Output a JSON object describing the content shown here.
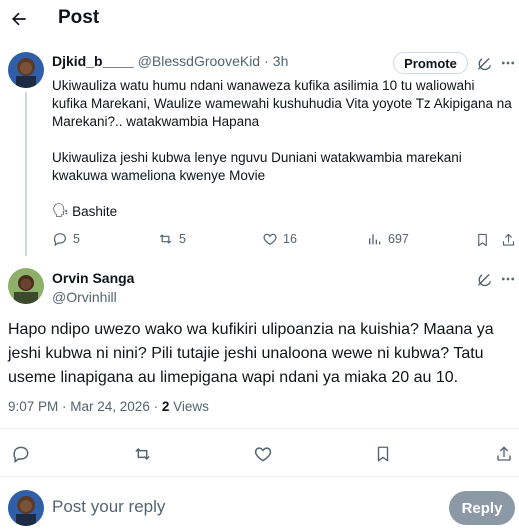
{
  "header": {
    "title": "Post"
  },
  "parent_post": {
    "author_name": "Djkid_b____",
    "author_handle": "@BlessdGrooveKid",
    "separator": "·",
    "time": "3h",
    "promote_label": "Promote",
    "paragraphs": [
      "Ukiwauliza watu humu ndani wanaweza kufika asilimia 10 tu waliowahi kufika Marekani, Waulize wamewahi kushuhudia Vita yoyote Tz Akipigana na Marekani?.. watakwambia Hapana",
      "Ukiwauliza jeshi kubwa lenye nguvu Duniani watakwambia marekani kwakuwa wameliona kwenye Movie"
    ],
    "signature_emoji": "🗣",
    "signature_text": "Bashite",
    "stats": {
      "replies": "5",
      "reposts": "5",
      "likes": "16",
      "views": "697"
    }
  },
  "reply_post": {
    "author_name": "Orvin Sanga",
    "author_handle": "@Orvinhill",
    "text": "Hapo ndipo uwezo wako wa kufikiri ulipoanzia na kuishia? Maana ya jeshi kubwa ni nini? Pili tutajie jeshi unaloona wewe ni kubwa? Tatu useme linapigana au limepigana wapi ndani ya miaka 20 au 10.",
    "timestamp": "9:07 PM · Mar 24, 2026 · ",
    "views_count": "2",
    "views_label": " Views"
  },
  "composer": {
    "placeholder": "Post your reply",
    "reply_label": "Reply"
  },
  "icons": [
    "back-arrow-icon",
    "grok-icon",
    "more-icon",
    "reply-icon",
    "repost-icon",
    "like-icon",
    "views-icon",
    "bookmark-icon",
    "share-icon"
  ],
  "colors": {
    "text": "#0f1419",
    "muted": "#536471",
    "border": "#eff3f4",
    "reply_button": "#8b98a5"
  }
}
